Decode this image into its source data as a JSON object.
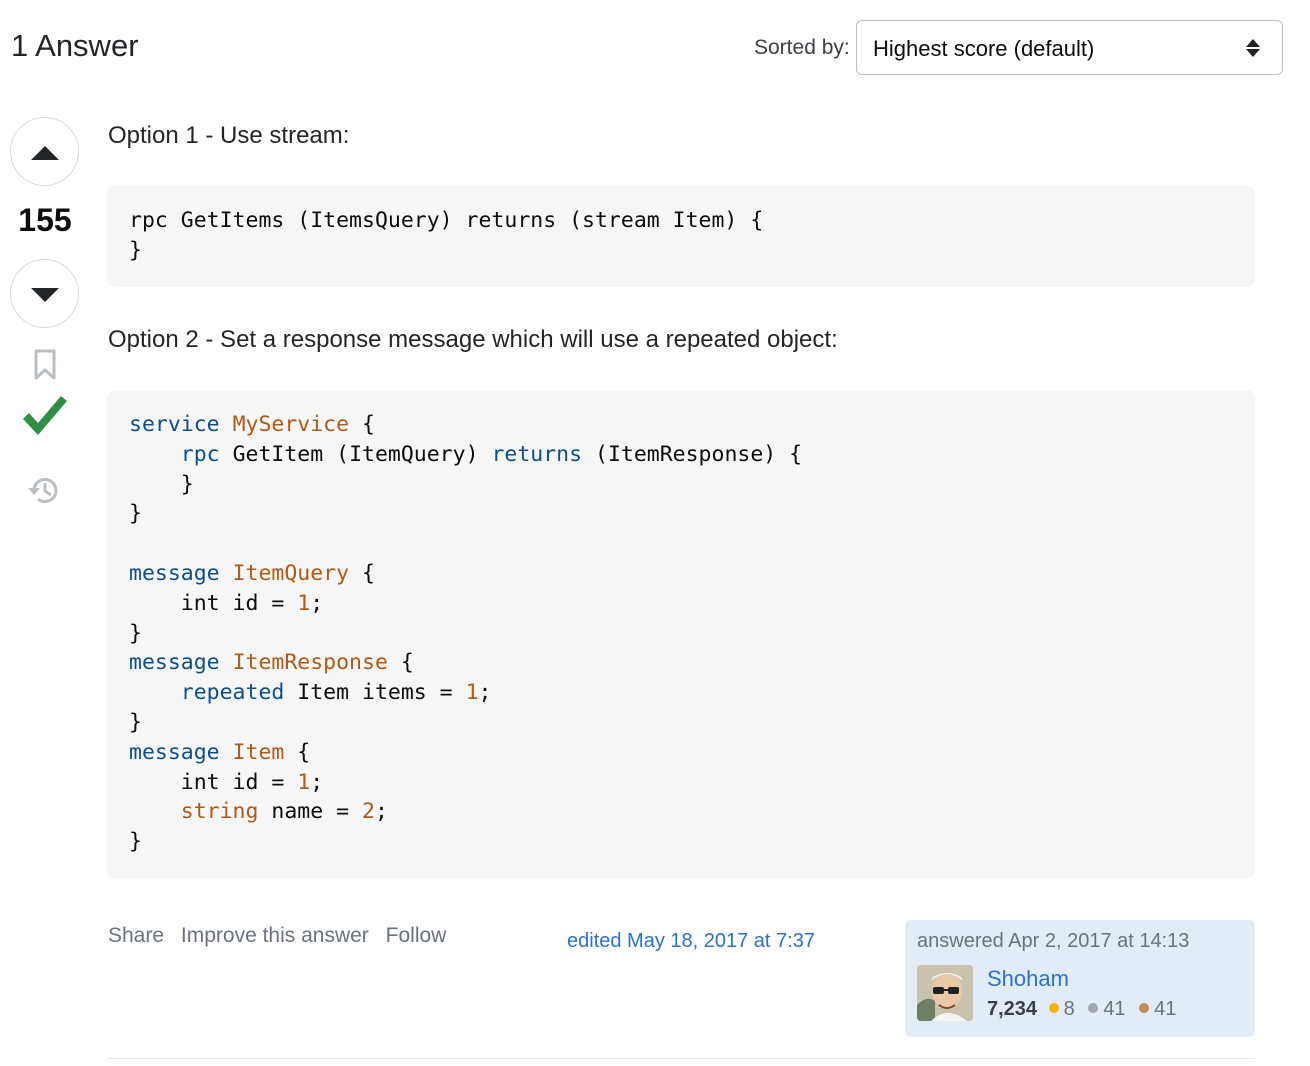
{
  "header": {
    "answers_count": "1 Answer",
    "sort_label": "Sorted by:",
    "sort_value": "Highest score (default)"
  },
  "vote": {
    "count": "155"
  },
  "post": {
    "option1_text": "Option 1 - Use stream:",
    "option2_text": "Option 2 - Set a response message which will use a repeated object:",
    "code1": [
      "rpc GetItems (ItemsQuery) returns (stream Item) {",
      "}"
    ],
    "code2_lines": [
      [
        {
          "t": "service",
          "c": "kw"
        },
        {
          "t": " "
        },
        {
          "t": "MyService",
          "c": "ty"
        },
        {
          "t": " {"
        }
      ],
      [
        {
          "t": "    "
        },
        {
          "t": "rpc",
          "c": "kw"
        },
        {
          "t": " GetItem (ItemQuery) "
        },
        {
          "t": "returns",
          "c": "kw"
        },
        {
          "t": " (ItemResponse) {"
        }
      ],
      [
        {
          "t": "    }"
        }
      ],
      [
        {
          "t": "}"
        }
      ],
      [
        {
          "t": ""
        }
      ],
      [
        {
          "t": "message",
          "c": "kw"
        },
        {
          "t": " "
        },
        {
          "t": "ItemQuery",
          "c": "ty"
        },
        {
          "t": " {"
        }
      ],
      [
        {
          "t": "    int id = "
        },
        {
          "t": "1",
          "c": "num"
        },
        {
          "t": ";"
        }
      ],
      [
        {
          "t": "}"
        }
      ],
      [
        {
          "t": "message",
          "c": "kw"
        },
        {
          "t": " "
        },
        {
          "t": "ItemResponse",
          "c": "ty"
        },
        {
          "t": " {"
        }
      ],
      [
        {
          "t": "    "
        },
        {
          "t": "repeated",
          "c": "kw"
        },
        {
          "t": " Item items = "
        },
        {
          "t": "1",
          "c": "num"
        },
        {
          "t": ";"
        }
      ],
      [
        {
          "t": "}"
        }
      ],
      [
        {
          "t": "message",
          "c": "kw"
        },
        {
          "t": " "
        },
        {
          "t": "Item",
          "c": "ty"
        },
        {
          "t": " {"
        }
      ],
      [
        {
          "t": "    int id = "
        },
        {
          "t": "1",
          "c": "num"
        },
        {
          "t": ";"
        }
      ],
      [
        {
          "t": "    "
        },
        {
          "t": "string",
          "c": "ty"
        },
        {
          "t": " name = "
        },
        {
          "t": "2",
          "c": "num"
        },
        {
          "t": ";"
        }
      ],
      [
        {
          "t": "}"
        }
      ]
    ]
  },
  "post_menu": {
    "share": "Share",
    "improve": "Improve this answer",
    "follow": "Follow"
  },
  "edited": "edited May 18, 2017 at 7:37",
  "user": {
    "answered": "answered Apr 2, 2017 at 14:13",
    "name": "Shoham",
    "reputation": "7,234",
    "gold": "8",
    "silver": "41",
    "bronze": "41"
  },
  "colors": {
    "keyword": "#0c4f8a",
    "type": "#b15a17",
    "link": "#2c72c7",
    "accepted": "#2f8f46"
  }
}
